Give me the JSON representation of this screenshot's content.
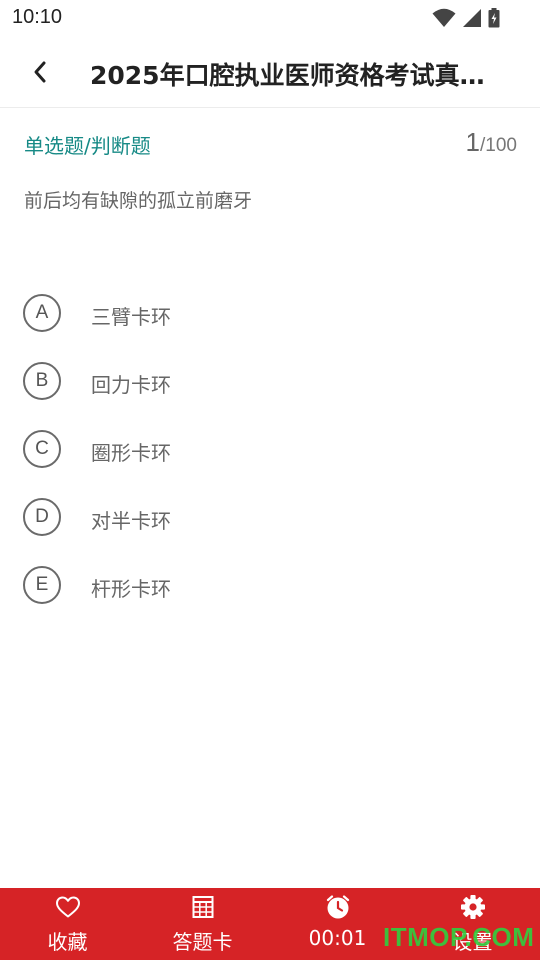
{
  "status_bar": {
    "time": "10:10",
    "icons": [
      "wifi-icon",
      "signal-icon",
      "battery-icon"
    ]
  },
  "app_bar": {
    "back_icon": "back-arrow-icon",
    "title": "2025年口腔执业医师资格考试真…"
  },
  "question": {
    "type_label": "单选题/判断题",
    "current": "1",
    "total": "/100",
    "text": "前后均有缺隙的孤立前磨牙"
  },
  "options": [
    {
      "letter": "A",
      "text": "三臂卡环"
    },
    {
      "letter": "B",
      "text": "回力卡环"
    },
    {
      "letter": "C",
      "text": "圈形卡环"
    },
    {
      "letter": "D",
      "text": "对半卡环"
    },
    {
      "letter": "E",
      "text": "杆形卡环"
    }
  ],
  "bottom_bar": {
    "tabs": [
      {
        "icon": "heart-icon",
        "label": "收藏"
      },
      {
        "icon": "grid-icon",
        "label": "答题卡"
      },
      {
        "icon": "clock-icon",
        "label": "00:01"
      },
      {
        "icon": "gear-icon",
        "label": "设置"
      }
    ]
  },
  "watermark": "ITMOP.COM",
  "colors": {
    "accent_teal": "#178a86",
    "bottom_bar_red": "#d62326",
    "watermark_green": "#2fcf3f"
  }
}
